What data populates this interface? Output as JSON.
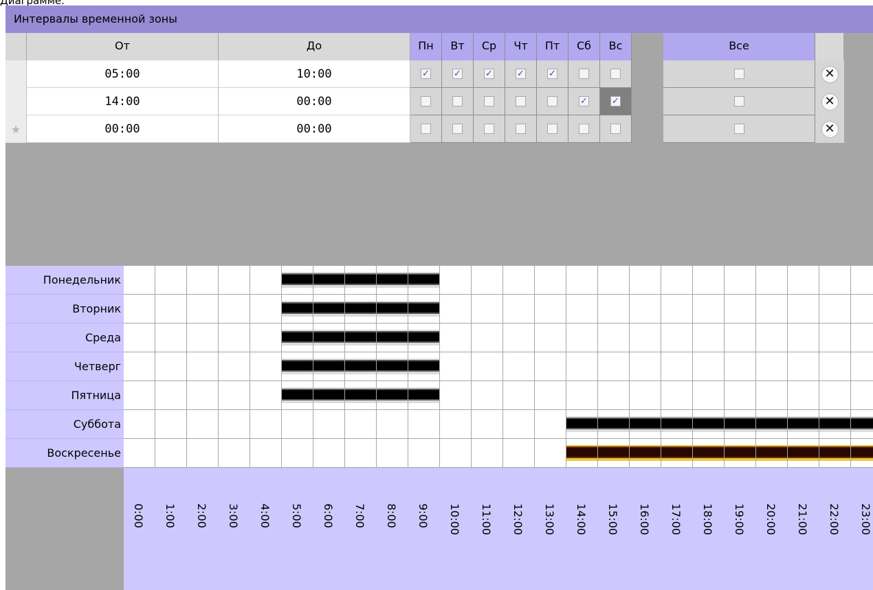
{
  "clipped_caption": "Диаграмме.",
  "panel_title": "Интервалы временной зоны",
  "columns": {
    "from": "От",
    "to": "До",
    "days": [
      "Пн",
      "Вт",
      "Ср",
      "Чт",
      "Пт",
      "Сб",
      "Вс"
    ],
    "all": "Все"
  },
  "intervals": [
    {
      "from": "05:00",
      "to": "10:00",
      "days": [
        true,
        true,
        true,
        true,
        true,
        false,
        false
      ],
      "all": false,
      "marker": ""
    },
    {
      "from": "14:00",
      "to": "00:00",
      "days": [
        false,
        false,
        false,
        false,
        false,
        true,
        true
      ],
      "all": false,
      "marker": ""
    },
    {
      "from": "00:00",
      "to": "00:00",
      "days": [
        false,
        false,
        false,
        false,
        false,
        false,
        false
      ],
      "all": false,
      "marker": "★"
    }
  ],
  "delete_glyph": "✕",
  "check_glyph": "✓",
  "diagram": {
    "days": [
      "Понедельник",
      "Вторник",
      "Среда",
      "Четверг",
      "Пятница",
      "Суббота",
      "Воскресенье"
    ],
    "hours": [
      "0:00",
      "1:00",
      "2:00",
      "3:00",
      "4:00",
      "5:00",
      "6:00",
      "7:00",
      "8:00",
      "9:00",
      "10:00",
      "11:00",
      "12:00",
      "13:00",
      "14:00",
      "15:00",
      "16:00",
      "17:00",
      "18:00",
      "19:00",
      "20:00",
      "21:00",
      "22:00",
      "23:00"
    ],
    "active": [
      {
        "day": 0,
        "from_hour": 5,
        "to_hour": 10
      },
      {
        "day": 1,
        "from_hour": 5,
        "to_hour": 10
      },
      {
        "day": 2,
        "from_hour": 5,
        "to_hour": 10
      },
      {
        "day": 3,
        "from_hour": 5,
        "to_hour": 10
      },
      {
        "day": 4,
        "from_hour": 5,
        "to_hour": 10
      },
      {
        "day": 5,
        "from_hour": 14,
        "to_hour": 24
      },
      {
        "day": 6,
        "from_hour": 14,
        "to_hour": 24,
        "highlighted": true
      }
    ]
  },
  "selected_cell": {
    "row": 1,
    "col": 6
  },
  "colors": {
    "header": "#978bd4",
    "day_header": "#b2a8f0",
    "label_bg": "#cec8ff",
    "bar": "#000000",
    "bar_selected": "#2a0800"
  }
}
